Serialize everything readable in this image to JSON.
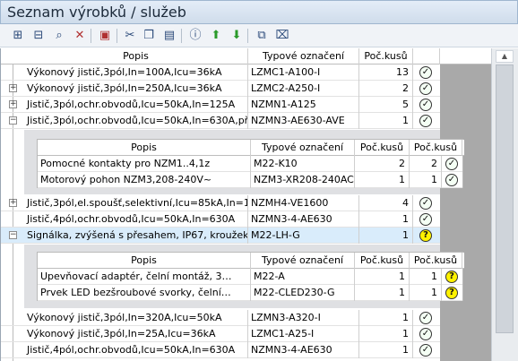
{
  "window": {
    "title": "Seznam výrobků / služeb"
  },
  "toolbar": {
    "icons": [
      "tree-expand-icon",
      "tree-collapse-icon",
      "binoculars-icon",
      "delete-filter-icon",
      "export-icon",
      "cut-icon",
      "copy-icon",
      "paste-icon",
      "info-icon",
      "arrow-up-icon",
      "arrow-down-icon",
      "copy-rows-icon",
      "clear-filter-icon"
    ]
  },
  "columns": {
    "desc": "Popis",
    "type": "Typové označení",
    "qty": "Poč.kusů"
  },
  "sub_columns": {
    "desc": "Popis",
    "type": "Typové označení",
    "qty": "Poč.kusů",
    "qty2": "Poč.kusů"
  },
  "rows": [
    {
      "desc": "Výkonový jistič,3pól,In=100A,Icu=36kA",
      "type": "LZMC1-A100-I",
      "qty": "13",
      "status": "ok"
    },
    {
      "desc": "Výkonový jistič,3pól,In=250A,Icu=36kA",
      "type": "LZMC2-A250-I",
      "qty": "2",
      "status": "ok"
    },
    {
      "desc": "Jistič,3pól,ochr.obvodů,Icu=50kA,In=125A",
      "type": "NZMN1-A125",
      "qty": "5",
      "status": "ok"
    },
    {
      "desc": "Jistič,3pól,ochr.obvodů,Icu=50kA,In=630A,přípr…",
      "type": "NZMN3-AE630-AVE",
      "qty": "1",
      "status": "ok"
    },
    {
      "desc": "Jistič,3pól,el.spoušť,selektivní,Icu=85kA,In=160…",
      "type": "NZMH4-VE1600",
      "qty": "4",
      "status": "ok"
    },
    {
      "desc": "Jistič,4pól,ochr.obvodů,Icu=50kA,In=630A",
      "type": "NZMN3-4-AE630",
      "qty": "1",
      "status": "ok"
    },
    {
      "desc": "Signálka, zvýšená s přesahem, IP67, kroužek…",
      "type": "M22-LH-G",
      "qty": "1",
      "status": "q"
    },
    {
      "desc": "Výkonový jistič,3pól,In=320A,Icu=50kA",
      "type": "LZMN3-A320-I",
      "qty": "1",
      "status": "ok"
    },
    {
      "desc": "Výkonový jistič,3pól,In=25A,Icu=36kA",
      "type": "LZMC1-A25-I",
      "qty": "1",
      "status": "ok"
    },
    {
      "desc": "Jistič,4pól,ochr.obvodů,Icu=50kA,In=630A",
      "type": "NZMN3-4-AE630",
      "qty": "1",
      "status": "ok"
    }
  ],
  "sub1": [
    {
      "desc": "Pomocné kontakty pro NZM1..4,1z",
      "type": "M22-K10",
      "qty": "2",
      "qty2": "2",
      "status": "ok"
    },
    {
      "desc": "Motorový pohon NZM3,208-240V~",
      "type": "NZM3-XR208-240AC",
      "qty": "1",
      "qty2": "1",
      "status": "ok"
    }
  ],
  "sub2": [
    {
      "desc": "Upevňovací adaptér, čelní montáž, 3…",
      "type": "M22-A",
      "qty": "1",
      "qty2": "1",
      "status": "q"
    },
    {
      "desc": "Prvek LED bezšroubové svorky, čelní…",
      "type": "M22-CLED230-G",
      "qty": "1",
      "qty2": "1",
      "status": "q"
    }
  ],
  "colors": {
    "ok": "#f4fff4",
    "question": "#fff200",
    "selected_row": "#d9ecfb"
  }
}
